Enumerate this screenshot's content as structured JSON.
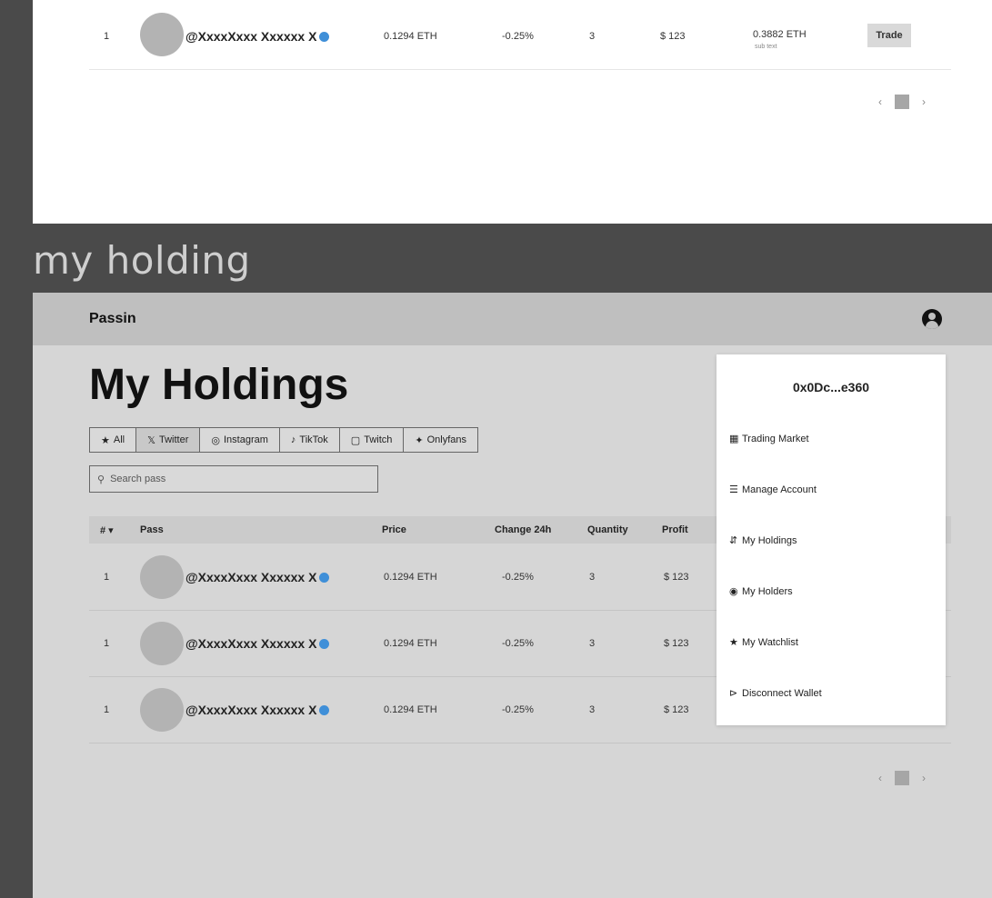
{
  "section_label": "my holding",
  "app": {
    "brand": "Passin",
    "account_icon": "account-circle-icon"
  },
  "page_title": "My Holdings",
  "filters": [
    {
      "icon": "★",
      "label": "All"
    },
    {
      "icon": "𝕏",
      "label": "Twitter"
    },
    {
      "icon": "◎",
      "label": "Instagram"
    },
    {
      "icon": "♪",
      "label": "TikTok"
    },
    {
      "icon": "▢",
      "label": "Twitch"
    },
    {
      "icon": "✦",
      "label": "Onlyfans"
    }
  ],
  "search": {
    "icon": "⚲",
    "placeholder": "Search pass"
  },
  "columns": {
    "rank": "# ▾",
    "pass": "Pass",
    "price": "Price",
    "change": "Change 24h",
    "quantity": "Quantity",
    "profit": "Profit"
  },
  "rows": [
    {
      "rank": "1",
      "handle": "@XxxxXxxx Xxxxxx X",
      "price": "0.1294 ETH",
      "change": "-0.25%",
      "quantity": "3",
      "profit": "$ 123"
    },
    {
      "rank": "1",
      "handle": "@XxxxXxxx Xxxxxx X",
      "price": "0.1294 ETH",
      "change": "-0.25%",
      "quantity": "3",
      "profit": "$ 123"
    },
    {
      "rank": "1",
      "handle": "@XxxxXxxx Xxxxxx X",
      "price": "0.1294 ETH",
      "change": "-0.25%",
      "quantity": "3",
      "profit": "$ 123"
    }
  ],
  "pager": {
    "prev": "‹",
    "next": "›"
  },
  "dropdown": {
    "wallet": "0x0Dc...e360",
    "items": [
      {
        "icon": "▦",
        "label": "Trading Market"
      },
      {
        "icon": "☰",
        "label": "Manage Account"
      },
      {
        "icon": "⇵",
        "label": "My Holdings"
      },
      {
        "icon": "◉",
        "label": "My Holders"
      },
      {
        "icon": "★",
        "label": "My Watchlist"
      },
      {
        "icon": "⊳",
        "label": "Disconnect Wallet"
      }
    ]
  },
  "top_frame": {
    "row": {
      "rank": "1",
      "handle": "@XxxxXxxx Xxxxxx X",
      "price": "0.1294 ETH",
      "change": "-0.25%",
      "quantity": "3",
      "profit": "$ 123",
      "eth": "0.3882 ETH",
      "eth_sub": "sub text",
      "trade": "Trade"
    }
  },
  "colors": {
    "verified": "#3f8fd8",
    "page_bg": "#4a4a4a"
  }
}
